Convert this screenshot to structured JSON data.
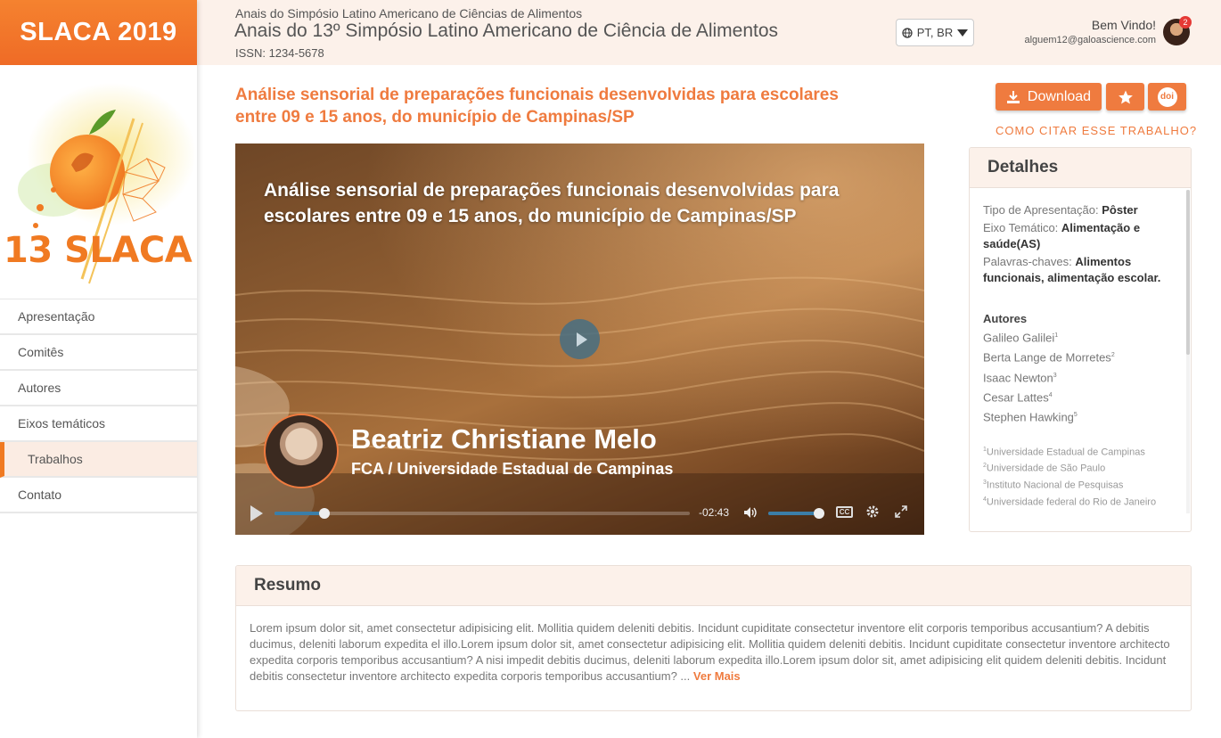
{
  "sidebar": {
    "brand": "SLACA 2019",
    "logo_text": "13 SLACA",
    "items": [
      {
        "label": "Apresentação"
      },
      {
        "label": "Comitês"
      },
      {
        "label": "Autores"
      },
      {
        "label": "Eixos temáticos"
      },
      {
        "label": "Trabalhos",
        "active": true
      },
      {
        "label": "Contato"
      }
    ]
  },
  "header": {
    "small": "Anais do Simpósio Latino Americano de Ciências de Alimentos",
    "title": "Anais do 13º Simpósio Latino Americano de Ciência de Alimentos",
    "issn": "ISSN: 1234-5678",
    "language": "PT, BR",
    "welcome": "Bem Vindo!",
    "email": "alguem12@galoascience.com",
    "notifications": "2"
  },
  "paper": {
    "title": "Análise sensorial de preparações funcionais desenvolvidas para escolares entre 09 e 15 anos, do município de Campinas/SP",
    "download_label": "Download",
    "doi_label": "doi",
    "cite_label": "COMO CITAR ESSE TRABALHO?"
  },
  "video": {
    "title": "Análise sensorial de preparações funcionais desenvolvidas para escolares entre 09 e 15 anos, do município de Campinas/SP",
    "presenter_name": "Beatriz Christiane Melo",
    "presenter_institution": "FCA / Universidade Estadual de Campinas",
    "time_remaining": "-02:43",
    "progress": 0.12,
    "volume": 0.95,
    "cc_label": "CC"
  },
  "details": {
    "heading": "Detalhes",
    "tipo_label": "Tipo de Apresentação:",
    "tipo_value": "Pôster",
    "eixo_label": "Eixo Temático:",
    "eixo_value": "Alimentação e saúde(AS)",
    "palavras_label": "Palavras-chaves:",
    "palavras_value": "Alimentos funcionais, alimentação escolar.",
    "authors_heading": "Autores",
    "authors": [
      {
        "name": "Galileo Galilei",
        "sup": "1"
      },
      {
        "name": "Berta Lange de Morretes",
        "sup": "2"
      },
      {
        "name": "Isaac Newton",
        "sup": "3"
      },
      {
        "name": "Cesar Lattes",
        "sup": "4"
      },
      {
        "name": "Stephen Hawking",
        "sup": "5"
      }
    ],
    "affiliations": [
      {
        "sup": "1",
        "name": "Universidade Estadual de Campinas"
      },
      {
        "sup": "2",
        "name": "Universidade de São Paulo"
      },
      {
        "sup": "3",
        "name": "Instituto Nacional de Pesquisas"
      },
      {
        "sup": "4",
        "name": "Universidade federal do Rio de Janeiro"
      }
    ]
  },
  "resumo": {
    "heading": "Resumo",
    "text": "Lorem ipsum dolor sit, amet consectetur adipisicing elit. Mollitia quidem deleniti debitis. Incidunt cupiditate consectetur inventore elit corporis temporibus accusantium? A debitis ducimus, deleniti laborum expedita el illo.Lorem ipsum dolor sit, amet consectetur adipisicing elit. Mollitia quidem deleniti debitis. Incidunt cupiditate consectetur inventore architecto expedita corporis temporibus accusantium? A nisi impedit debitis ducimus, deleniti laborum expedita illo.Lorem ipsum dolor sit, amet adipisicing elit quidem deleniti debitis. Incidunt debitis consectetur inventore architecto expedita corporis temporibus accusantium? ...",
    "more_label": "Ver Mais"
  },
  "colors": {
    "accent": "#ef7b3f",
    "header_bg": "#fcf1ea"
  }
}
